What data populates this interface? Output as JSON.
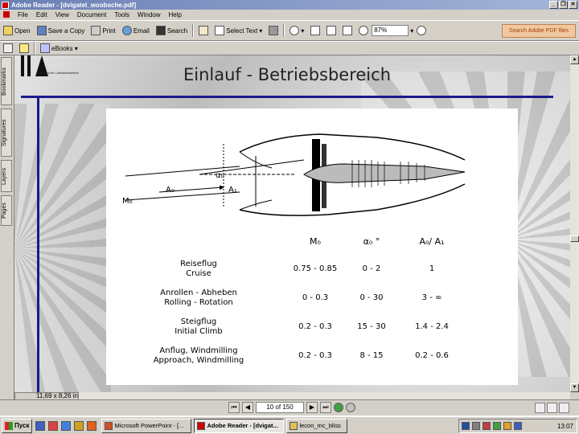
{
  "window": {
    "title": "Adobe Reader - [dvigatel_woobsche.pdf]",
    "controls": [
      "_",
      "❐",
      "✕"
    ]
  },
  "menu": [
    "File",
    "Edit",
    "View",
    "Document",
    "Tools",
    "Window",
    "Help"
  ],
  "toolbar": {
    "open": "Open",
    "save_copy": "Save a Copy",
    "print": "Print",
    "email": "Email",
    "search": "Search",
    "select_text": "Select Text",
    "zoom_value": "87%",
    "search_pdf": "Search Adobe PDF files",
    "ebooks": "eBooks"
  },
  "nav_tabs": [
    "Bookmarks",
    "Signatures",
    "Layers",
    "Pages"
  ],
  "slide": {
    "logo_caption": "Institut für Luftfahrtantriebe",
    "title": "Einlauf - Betriebsbereich",
    "diagram_labels": {
      "m0": "M₀",
      "a0": "A₀",
      "a1": "A₁",
      "alpha0": "α₀"
    },
    "table": {
      "headers": [
        "M₀",
        "α₀ °",
        "A₀/ A₁"
      ],
      "rows": [
        {
          "label": "Reiseflug",
          "sublabel": "Cruise",
          "m0": "0.75 - 0.85",
          "alpha": "0 - 2",
          "ratio": "1"
        },
        {
          "label": "Anrollen - Abheben",
          "sublabel": "Rolling - Rotation",
          "m0": "0  - 0.3",
          "alpha": "0 - 30",
          "ratio": "3  -  ∞"
        },
        {
          "label": "Steigflug",
          "sublabel": "Initial Climb",
          "m0": "0.2 - 0.3",
          "alpha": "15 - 30",
          "ratio": "1.4 - 2.4"
        },
        {
          "label": "Anflug, Windmilling",
          "sublabel": "Approach, Windmilling",
          "m0": "0.2  - 0.3",
          "alpha": "8 - 15",
          "ratio": "0.2 - 0.6"
        }
      ]
    }
  },
  "status": {
    "page_size": "11,69 x 8,26 in",
    "page_field": "10 of 150"
  },
  "taskbar": {
    "start": "Пуск",
    "tasks": [
      "Microsoft PowerPoint - [...",
      "Adobe Reader - [dvigat...",
      "lecon_mc_bliss"
    ],
    "active_index": 1,
    "clock": "13:07"
  }
}
